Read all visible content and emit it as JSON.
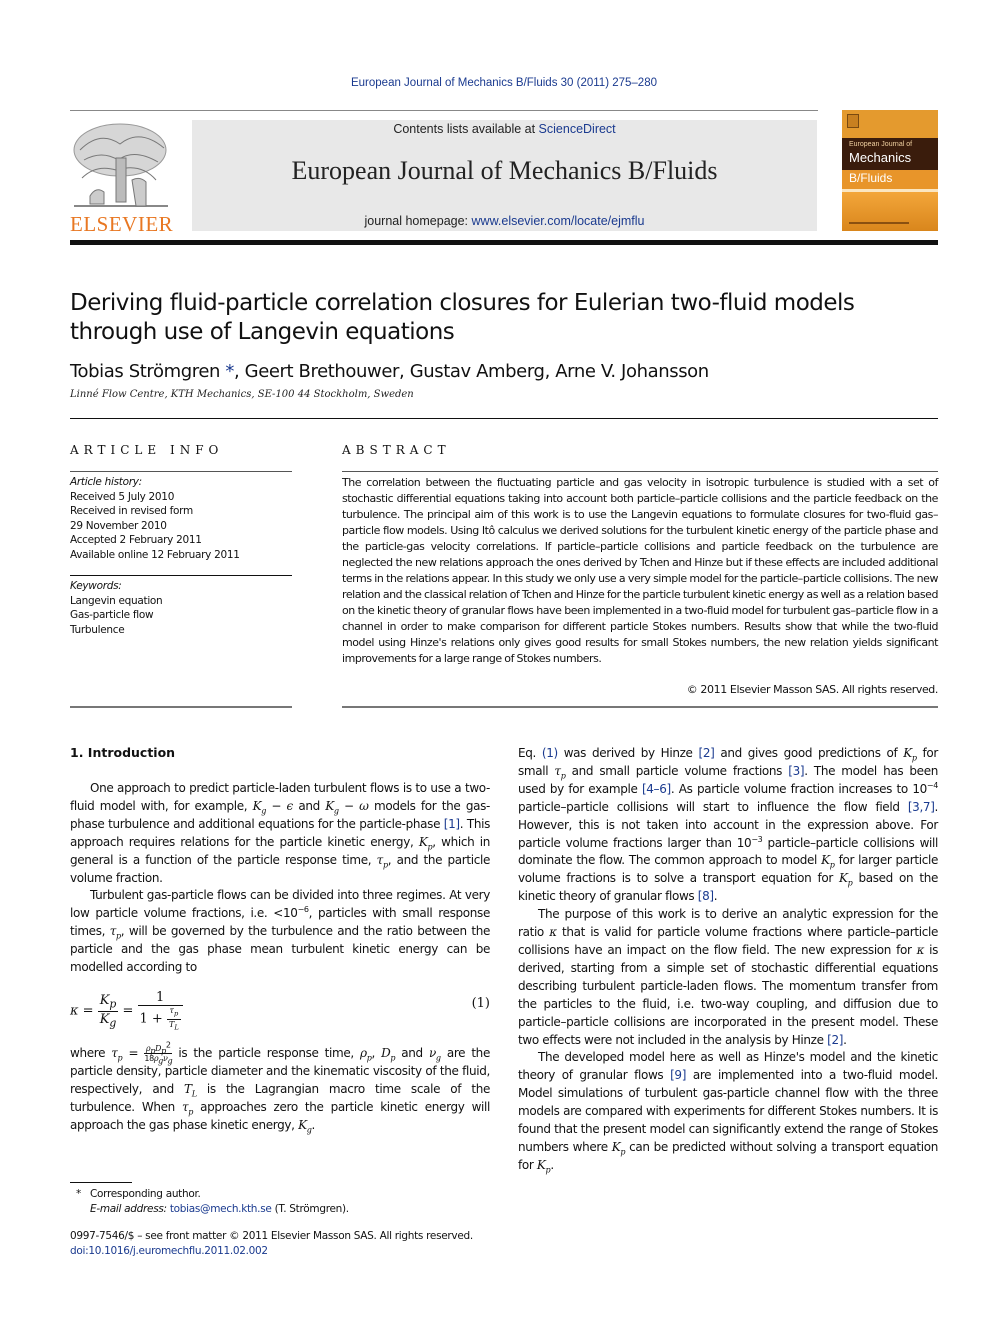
{
  "header": {
    "journal_ref": "European Journal of Mechanics B/Fluids 30 (2011) 275–280",
    "contents_prefix": "Contents lists available at ",
    "contents_link": "ScienceDirect",
    "journal_title": "European Journal of Mechanics B/Fluids",
    "homepage_prefix": "journal homepage: ",
    "homepage_link": "www.elsevier.com/locate/ejmflu",
    "publisher_logo_text": "ELSEVIER",
    "cover": {
      "small": "European Journal of",
      "main": "Mechanics",
      "sub": "B/Fluids"
    },
    "colors": {
      "link": "#1a3a8f",
      "elsevier_orange": "#e87722",
      "banner_bg": "#e8e8e8",
      "cover_orange": "#e8952a",
      "cover_dark": "#3a1c0c"
    }
  },
  "article": {
    "title": "Deriving fluid-particle correlation closures for Eulerian two-fluid models through use of Langevin equations",
    "authors": [
      {
        "name": "Tobias Strömgren",
        "mark": "*"
      },
      {
        "name": "Geert Brethouwer",
        "mark": ""
      },
      {
        "name": "Gustav Amberg",
        "mark": ""
      },
      {
        "name": "Arne V. Johansson",
        "mark": ""
      }
    ],
    "affiliation": "Linné Flow Centre, KTH Mechanics, SE-100 44 Stockholm, Sweden"
  },
  "article_info": {
    "heading": "ARTICLE INFO",
    "history_label": "Article history:",
    "history": [
      "Received 5 July 2010",
      "Received in revised form",
      "29 November 2010",
      "Accepted 2 February 2011",
      "Available online 12 February 2011"
    ],
    "keywords_label": "Keywords:",
    "keywords": [
      "Langevin equation",
      "Gas-particle flow",
      "Turbulence"
    ]
  },
  "abstract": {
    "heading": "ABSTRACT",
    "text": "The correlation between the fluctuating particle and gas velocity in isotropic turbulence is studied with a set of stochastic differential equations taking into account both particle–particle collisions and the particle feedback on the turbulence. The principal aim of this work is to use the Langevin equations to formulate closures for two-fluid gas–particle flow models. Using Itô calculus we derived solutions for the turbulent kinetic energy of the particle phase and the particle-gas velocity correlations. If particle–particle collisions and particle feedback on the turbulence are neglected the new relations approach the ones derived by Tchen and Hinze but if these effects are included additional terms in the relations appear. In this study we only use a very simple model for the particle–particle collisions. The new relation and the classical relation of Tchen and Hinze for the particle turbulent kinetic energy as well as a relation based on the kinetic theory of granular flows have been implemented in a two-fluid model for turbulent gas–particle flow in a channel in order to make comparison for different particle Stokes numbers. Results show that while the two-fluid model using Hinze's relations only gives good results for small Stokes numbers, the new relation yields significant improvements for a large range of Stokes numbers.",
    "copyright": "© 2011 Elsevier Masson SAS. All rights reserved."
  },
  "body": {
    "section1_heading": "1.  Introduction",
    "p1": {
      "a": "One approach to predict particle-laden turbulent flows is to use a two-fluid model with, for example, ",
      "b": " and ",
      "c": " models for the gas-phase turbulence and additional equations for the particle-phase ",
      "ref1": "[1]",
      "d": ". This approach requires relations for the particle kinetic energy, ",
      "e": ", which in general is a function of the particle response time, ",
      "f": ", and the particle volume fraction."
    },
    "p2": {
      "a": "Turbulent gas-particle flows can be divided into three regimes. At very low particle volume fractions, i.e. <10",
      "exp": "−6",
      "b": ", particles with small response times, ",
      "c": ", will be governed by the turbulence and the ratio between the particle and the gas phase mean turbulent kinetic energy can be modelled according to"
    },
    "equation1_number": "(1)",
    "p3": {
      "a": "where ",
      "b": " is the particle response time, ",
      "c": " and ",
      "d": " are the particle density, particle diameter and the kinematic viscosity of the fluid, respectively, and ",
      "e": " is the Lagrangian macro time scale of the turbulence. When ",
      "f": " approaches zero the particle kinetic energy will approach the gas phase kinetic energy, ",
      "g": "."
    },
    "p4": {
      "a": "Eq. ",
      "ref_eq": "(1)",
      "b": " was derived by Hinze ",
      "ref2": "[2]",
      "c": " and gives good predictions of ",
      "d": " for small ",
      "e": " and small particle volume fractions ",
      "ref3": "[3]",
      "f": ". The model has been used by for example ",
      "ref46": "[4–6]",
      "g": ". As particle volume fraction increases to 10",
      "exp1": "−4",
      "h": " particle–particle collisions will start to influence the flow field ",
      "ref37": "[3,7]",
      "i": ". However, this is not taken into account in the expression above. For particle volume fractions larger than 10",
      "exp2": "−3",
      "j": " particle–particle collisions will dominate the flow. The common approach to model ",
      "k": " for larger particle volume fractions is to solve a transport equation for ",
      "l": " based on the kinetic theory of granular flows ",
      "ref8": "[8]",
      "m": "."
    },
    "p5": {
      "a": "The purpose of this work is to derive an analytic expression for the ratio ",
      "b": " that is valid for particle volume fractions where particle–particle collisions have an impact on the flow field. The new expression for ",
      "c": " is derived, starting from a simple set of stochastic differential equations describing turbulent particle-laden flows. The momentum transfer from the particles to the fluid, i.e. two-way coupling, and diffusion due to particle–particle collisions are incorporated in the present model. These two effects were not included in the analysis by Hinze ",
      "ref2": "[2]",
      "d": "."
    },
    "p6": {
      "a": "The developed model here as well as Hinze's model and the kinetic theory of granular flows ",
      "ref9": "[9]",
      "b": " are implemented into a two-fluid model. Model simulations of turbulent gas-particle channel flow with the three models are compared with experiments for different Stokes numbers. It is found that the present model can significantly extend the range of Stokes numbers where ",
      "c": " can be predicted without solving a transport equation for ",
      "d": "."
    }
  },
  "footnote": {
    "mark": "*",
    "corresponding": "Corresponding author.",
    "email_label": "E-mail address:",
    "email": "tobias@mech.kth.se",
    "email_suffix": " (T. Strömgren)."
  },
  "front_matter": {
    "issn_line": "0997-7546/$ – see front matter © 2011 Elsevier Masson SAS. All rights reserved.",
    "doi": "doi:10.1016/j.euromechflu.2011.02.002"
  }
}
